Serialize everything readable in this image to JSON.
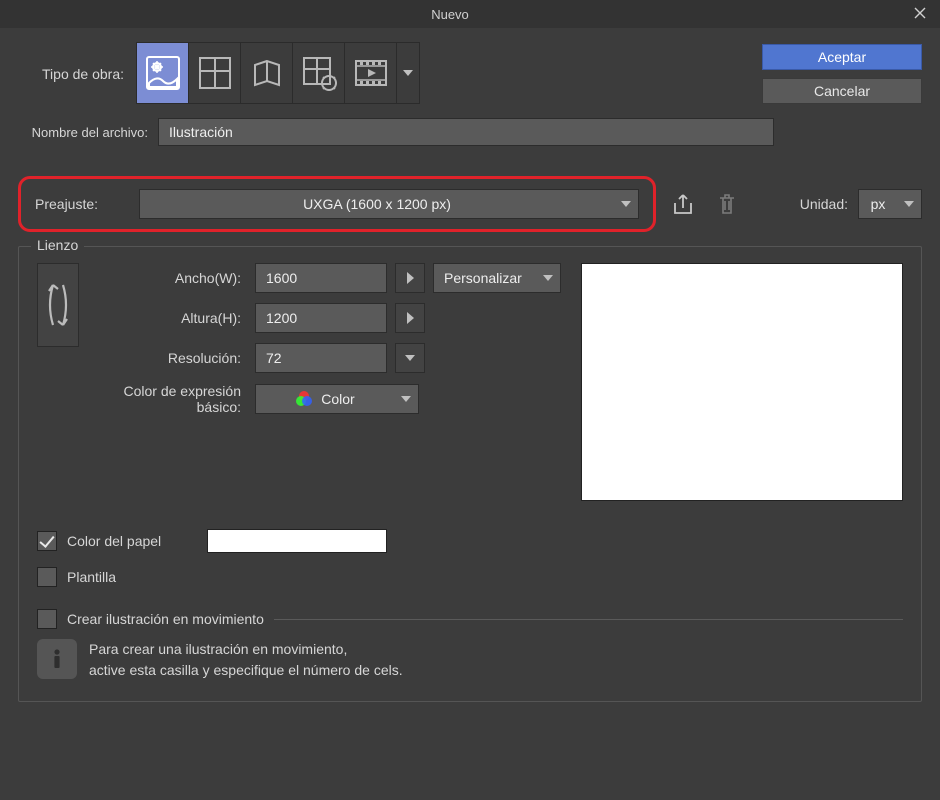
{
  "title": "Nuevo",
  "buttons": {
    "accept": "Aceptar",
    "cancel": "Cancelar"
  },
  "workType": {
    "label": "Tipo de obra:"
  },
  "fileName": {
    "label": "Nombre del archivo:",
    "value": "Ilustración"
  },
  "preset": {
    "label": "Preajuste:",
    "value": "UXGA (1600 x 1200 px)"
  },
  "unit": {
    "label": "Unidad:",
    "value": "px"
  },
  "canvas": {
    "legend": "Lienzo",
    "widthLabel": "Ancho(W):",
    "width": "1600",
    "heightLabel": "Altura(H):",
    "height": "1200",
    "resolutionLabel": "Resolución:",
    "resolution": "72",
    "customLabel": "Personalizar",
    "colorModeLabel": "Color de expresión básico:",
    "colorModeValue": "Color",
    "paperColorLabel": "Color del papel",
    "templateLabel": "Plantilla"
  },
  "moving": {
    "label": "Crear ilustración en movimiento",
    "info1": "Para crear una ilustración en movimiento,",
    "info2": "active esta casilla y especifique el número de cels."
  }
}
